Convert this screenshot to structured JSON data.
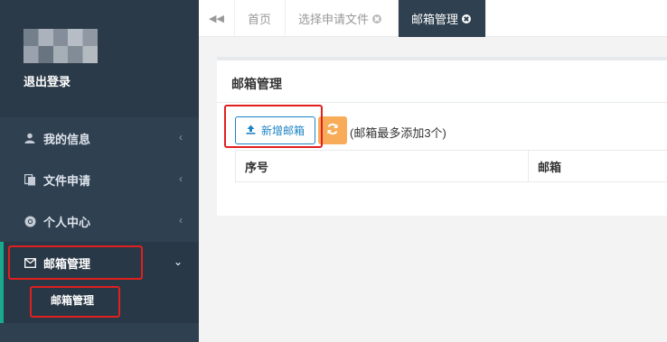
{
  "sidebar": {
    "logout_label": "退出登录",
    "items": [
      {
        "label": "我的信息",
        "icon": "user-icon"
      },
      {
        "label": "文件申请",
        "icon": "files-icon"
      },
      {
        "label": "个人中心",
        "icon": "chrome-icon"
      },
      {
        "label": "邮箱管理",
        "icon": "envelope-icon"
      }
    ],
    "sub_items": [
      {
        "label": "邮箱管理"
      }
    ]
  },
  "tabs": [
    {
      "label": "首页",
      "closable": false,
      "active": false
    },
    {
      "label": "选择申请文件",
      "closable": true,
      "active": false
    },
    {
      "label": "邮箱管理",
      "closable": true,
      "active": true
    }
  ],
  "panel": {
    "title": "邮箱管理",
    "add_button_label": "新增邮箱",
    "note": "(邮箱最多添加3个)",
    "table_headers": [
      "序号",
      "邮箱"
    ]
  },
  "colors": {
    "sidebar_bg": "#2f4050",
    "accent": "#19aa8d",
    "primary": "#1c84c6",
    "warning": "#f8ac59",
    "highlight": "#e0201f"
  }
}
